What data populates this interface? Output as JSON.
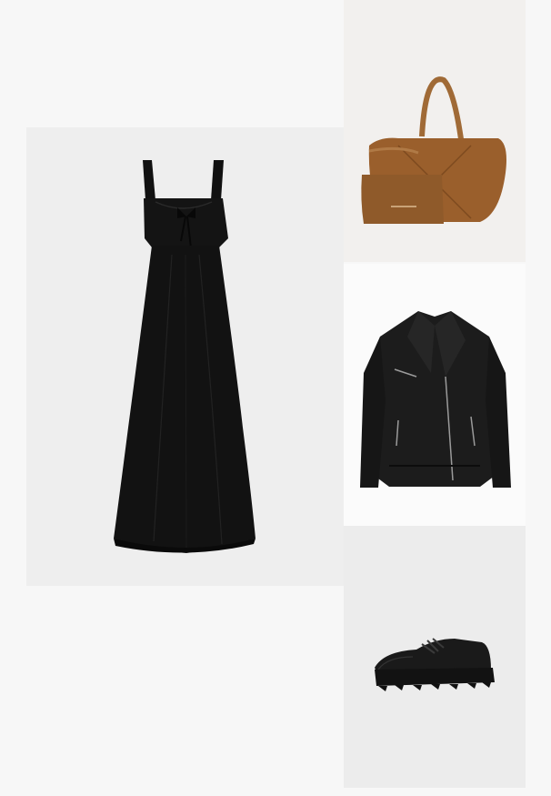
{
  "outfit": {
    "items": [
      {
        "id": "dress",
        "icon": "black-maxi-dress-photo"
      },
      {
        "id": "bag",
        "icon": "tan-leather-tote-bag-photo"
      },
      {
        "id": "jacket",
        "icon": "black-leather-biker-jacket-photo"
      },
      {
        "id": "shoes",
        "icon": "black-chunky-derby-shoe-photo"
      }
    ],
    "colors": {
      "page_background": "#f7f7f7",
      "dress": "#111111",
      "bag": "#9a5f2c",
      "jacket": "#1c1c1c",
      "shoe": "#161616"
    }
  }
}
